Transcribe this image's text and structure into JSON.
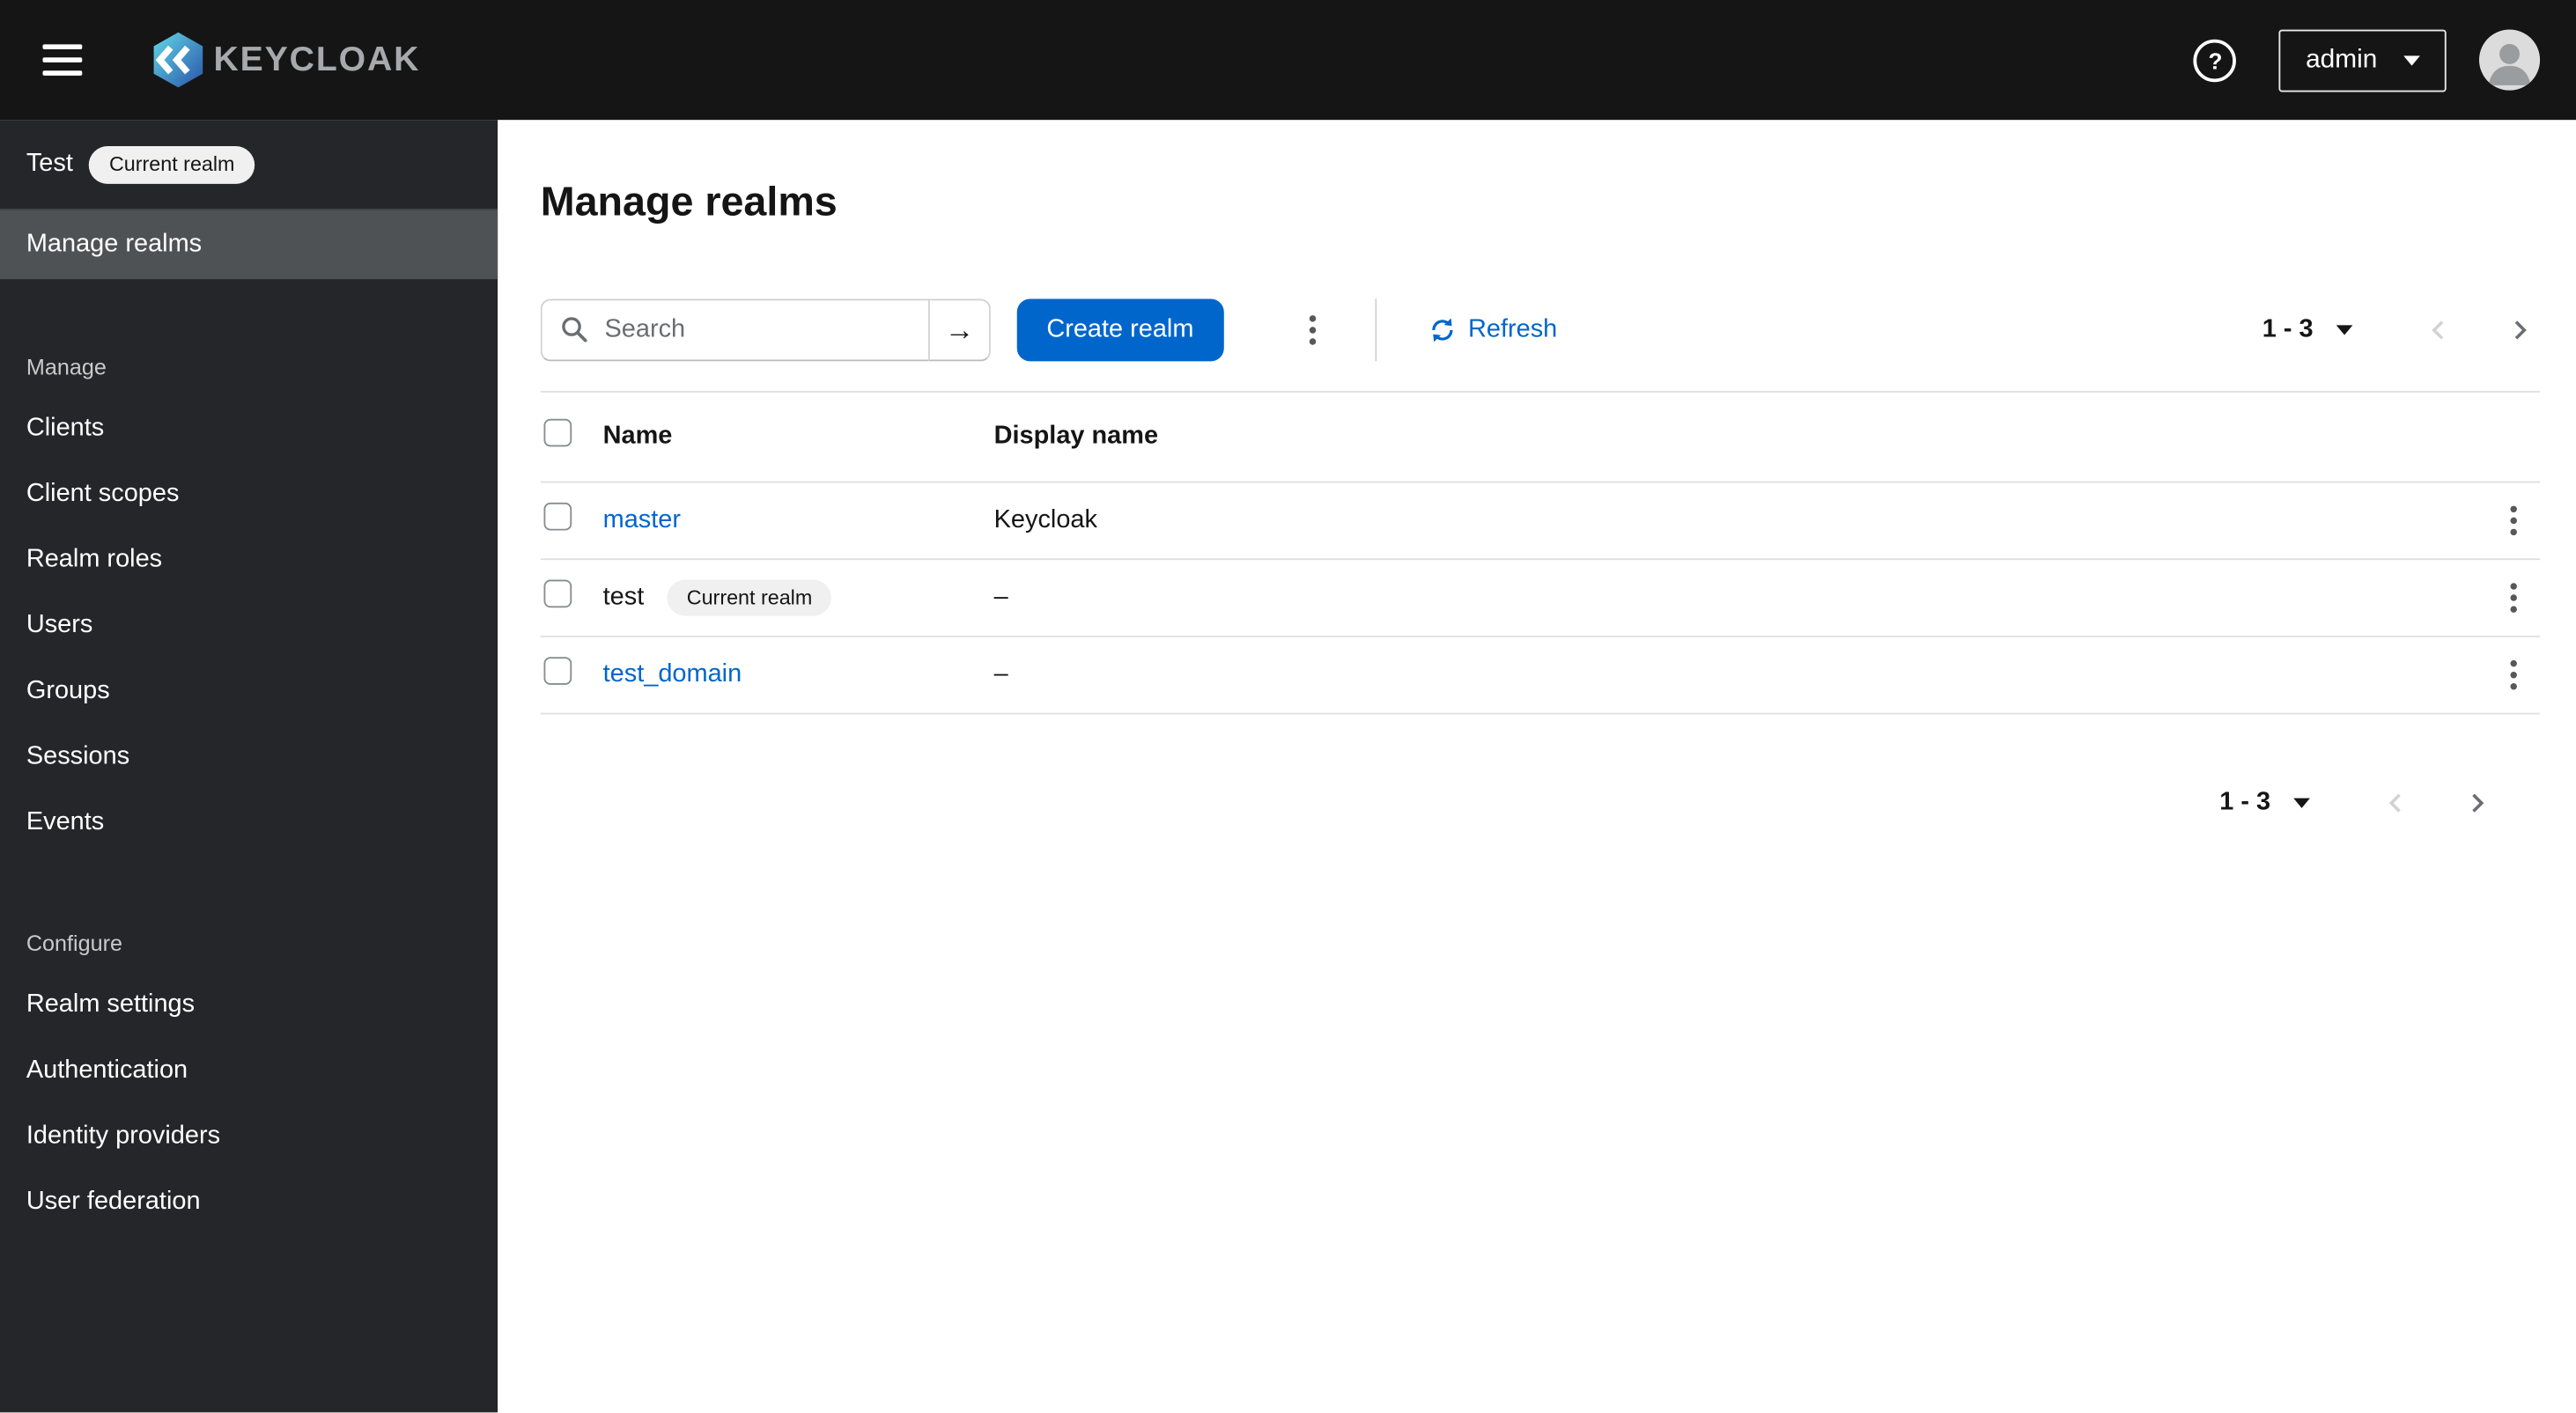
{
  "topbar": {
    "brand": "KEYCLOAK",
    "user": "admin"
  },
  "icons": {
    "help": "?",
    "hamburger": "three-bars",
    "search": "magnifier",
    "search_submit": "→",
    "kebab": "vertical-dots",
    "refresh": "sync-arrows",
    "caret_down": "triangle-down",
    "chevron_left": "angle-left",
    "chevron_right": "angle-right",
    "avatar": "person-silhouette"
  },
  "sidebar": {
    "realm_name": "Test",
    "realm_badge": "Current realm",
    "manage_realms": "Manage realms",
    "sections": [
      {
        "label": "Manage",
        "items": [
          "Clients",
          "Client scopes",
          "Realm roles",
          "Users",
          "Groups",
          "Sessions",
          "Events"
        ]
      },
      {
        "label": "Configure",
        "items": [
          "Realm settings",
          "Authentication",
          "Identity providers",
          "User federation"
        ]
      }
    ]
  },
  "main": {
    "title": "Manage realms",
    "toolbar": {
      "search_placeholder": "Search",
      "create_button": "Create realm",
      "refresh_label": "Refresh",
      "pagination_range": "1 - 3"
    },
    "table": {
      "columns": [
        "Name",
        "Display name"
      ],
      "rows": [
        {
          "name": "master",
          "display_name": "Keycloak"
        },
        {
          "name": "test",
          "badge": "Current realm",
          "display_name": "–"
        },
        {
          "name": "test_domain",
          "display_name": "–"
        }
      ]
    },
    "pagination_bottom_range": "1 - 3"
  },
  "colors": {
    "accent": "#0066cc",
    "topbar_bg": "#151515",
    "sidebar_bg": "#24262a",
    "sidebar_active_bg": "#4f5255",
    "link": "#0066cc",
    "badge_bg": "#f0f0f0",
    "border": "#e0e0e0"
  }
}
